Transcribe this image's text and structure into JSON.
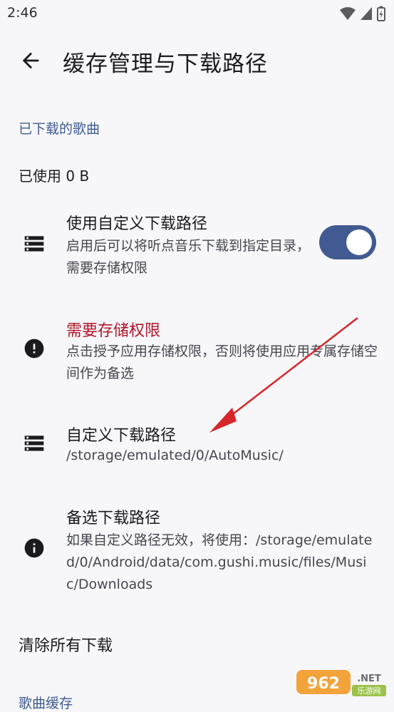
{
  "status_bar": {
    "time": "2:46"
  },
  "app_bar": {
    "title": "缓存管理与下载路径"
  },
  "sections": {
    "downloaded_songs": "已下载的歌曲",
    "song_cache": "歌曲缓存"
  },
  "used": "已使用 0 B",
  "custom_path_toggle": {
    "title": "使用自定义下载路径",
    "subtitle": "启用后可以将听点音乐下载到指定目录，需要存储权限",
    "enabled": true
  },
  "storage_permission": {
    "title": "需要存储权限",
    "subtitle": "点击授予应用存储权限，否则将使用应用专属存储空间作为备选"
  },
  "custom_path": {
    "title": "自定义下载路径",
    "value": "/storage/emulated/0/AutoMusic/"
  },
  "fallback_path": {
    "title": "备选下载路径",
    "subtitle": "如果自定义路径无效，将使用：/storage/emulated/0/Android/data/com.gushi.music/files/Music/Downloads"
  },
  "clear_all": "清除所有下载",
  "watermark": {
    "brand": "962.NET",
    "site": "乐游网"
  },
  "colors": {
    "accent": "#415a91",
    "warning": "#b0152b",
    "annotation_arrow": "#d6262a"
  }
}
